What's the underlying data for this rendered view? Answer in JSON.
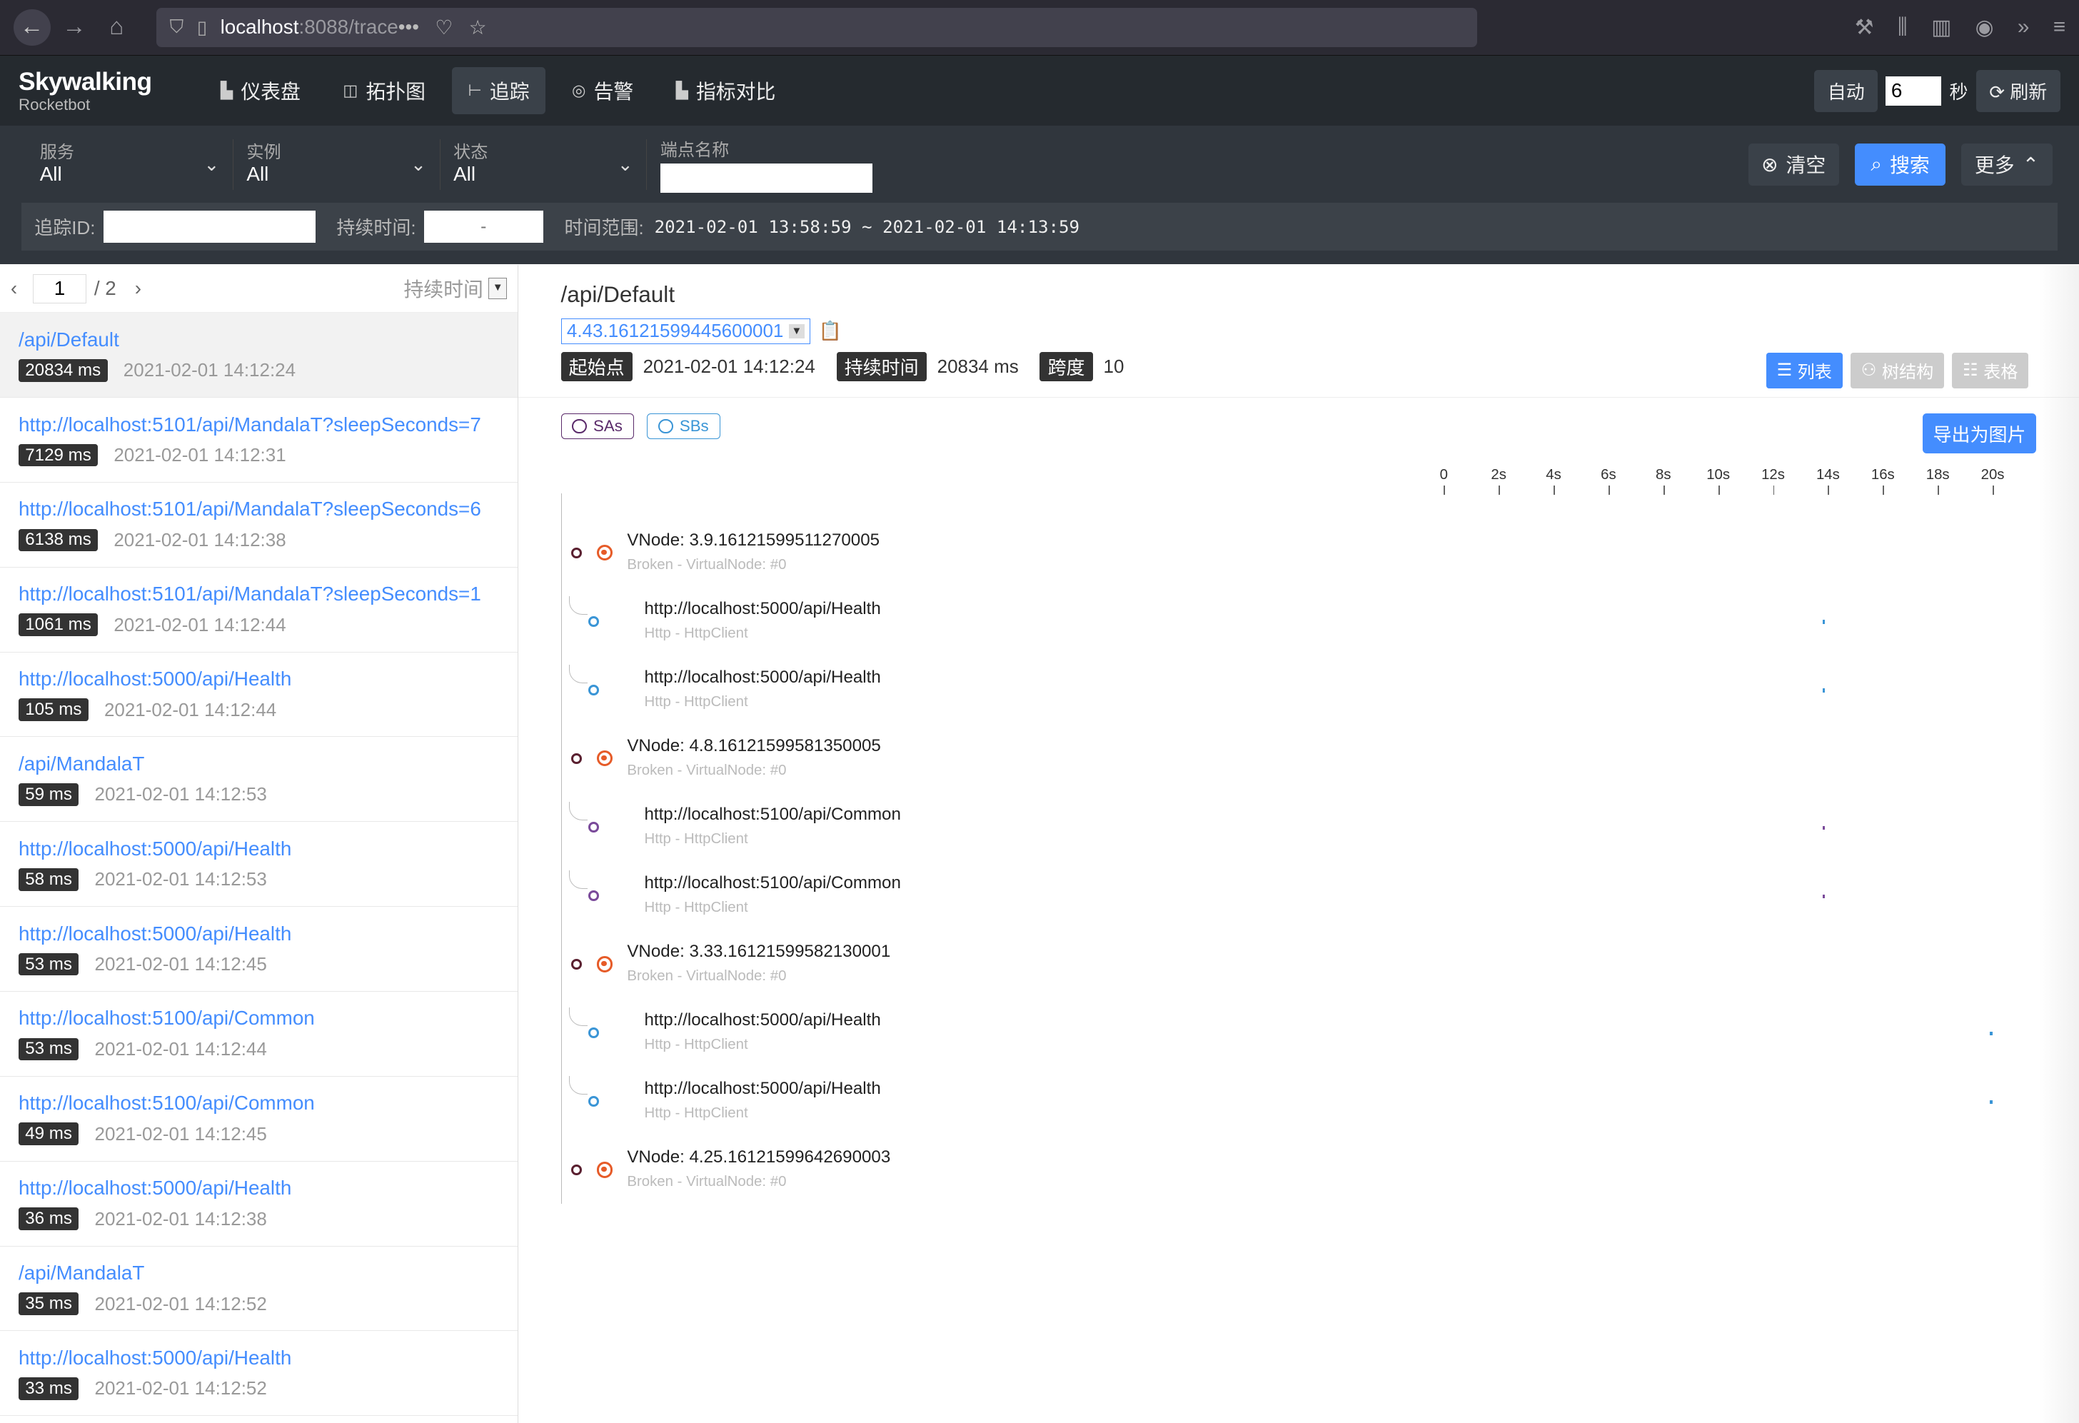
{
  "browser": {
    "host": "localhost",
    "path": ":8088/trace"
  },
  "app": {
    "logo_main": "Skywalking",
    "logo_sub": "Rocketbot",
    "menu": [
      {
        "label": "仪表盘",
        "icon": "dashboard-icon"
      },
      {
        "label": "拓扑图",
        "icon": "topology-icon"
      },
      {
        "label": "追踪",
        "icon": "trace-icon",
        "active": true
      },
      {
        "label": "告警",
        "icon": "alarm-icon"
      },
      {
        "label": "指标对比",
        "icon": "compare-icon"
      }
    ],
    "auto_label": "自动",
    "interval_value": "6",
    "seconds_label": "秒",
    "refresh_label": "刷新"
  },
  "filters": {
    "service": {
      "label": "服务",
      "value": "All"
    },
    "instance": {
      "label": "实例",
      "value": "All"
    },
    "status": {
      "label": "状态",
      "value": "All"
    },
    "endpoint": {
      "label": "端点名称",
      "value": ""
    },
    "clear_label": "清空",
    "search_label": "搜索",
    "more_label": "更多",
    "trace_id_label": "追踪ID:",
    "duration_label": "持续时间:",
    "duration_placeholder": "-",
    "range_label": "时间范围:",
    "range_value": "2021-02-01 13:58:59 ~ 2021-02-01 14:13:59"
  },
  "list": {
    "page": "1",
    "total": "/ 2",
    "sort_label": "持续时间",
    "items": [
      {
        "endpoint": "/api/Default",
        "duration": "20834 ms",
        "time": "2021-02-01 14:12:24"
      },
      {
        "endpoint": "http://localhost:5101/api/MandalaT?sleepSeconds=7",
        "duration": "7129 ms",
        "time": "2021-02-01 14:12:31"
      },
      {
        "endpoint": "http://localhost:5101/api/MandalaT?sleepSeconds=6",
        "duration": "6138 ms",
        "time": "2021-02-01 14:12:38"
      },
      {
        "endpoint": "http://localhost:5101/api/MandalaT?sleepSeconds=1",
        "duration": "1061 ms",
        "time": "2021-02-01 14:12:44"
      },
      {
        "endpoint": "http://localhost:5000/api/Health",
        "duration": "105 ms",
        "time": "2021-02-01 14:12:44"
      },
      {
        "endpoint": "/api/MandalaT",
        "duration": "59 ms",
        "time": "2021-02-01 14:12:53"
      },
      {
        "endpoint": "http://localhost:5000/api/Health",
        "duration": "58 ms",
        "time": "2021-02-01 14:12:53"
      },
      {
        "endpoint": "http://localhost:5000/api/Health",
        "duration": "53 ms",
        "time": "2021-02-01 14:12:45"
      },
      {
        "endpoint": "http://localhost:5100/api/Common",
        "duration": "53 ms",
        "time": "2021-02-01 14:12:44"
      },
      {
        "endpoint": "http://localhost:5100/api/Common",
        "duration": "49 ms",
        "time": "2021-02-01 14:12:45"
      },
      {
        "endpoint": "http://localhost:5000/api/Health",
        "duration": "36 ms",
        "time": "2021-02-01 14:12:38"
      },
      {
        "endpoint": "/api/MandalaT",
        "duration": "35 ms",
        "time": "2021-02-01 14:12:52"
      },
      {
        "endpoint": "http://localhost:5000/api/Health",
        "duration": "33 ms",
        "time": "2021-02-01 14:12:52"
      }
    ]
  },
  "detail": {
    "title": "/api/Default",
    "trace_id": "4.43.16121599445600001",
    "start_label": "起始点",
    "start_value": "2021-02-01 14:12:24",
    "duration_label": "持续时间",
    "duration_value": "20834 ms",
    "spans_label": "跨度",
    "spans_value": "10",
    "view_list": "列表",
    "view_tree": "树结构",
    "view_table": "表格",
    "sas_label": "SAs",
    "sbs_label": "SBs",
    "export_label": "导出为图片",
    "axis_ticks": [
      "0",
      "2s",
      "4s",
      "6s",
      "8s",
      "10s",
      "12s",
      "14s",
      "16s",
      "18s",
      "20s"
    ],
    "spans": [
      {
        "name": "VNode: 3.9.16121599511270005",
        "type": "Broken - VirtualNode: #0",
        "kind": "vnode"
      },
      {
        "name": "http://localhost:5000/api/Health",
        "type": "Http - HttpClient",
        "kind": "blue",
        "start_s": 13.8
      },
      {
        "name": "http://localhost:5000/api/Health",
        "type": "Http - HttpClient",
        "kind": "blue",
        "start_s": 13.8
      },
      {
        "name": "VNode: 4.8.16121599581350005",
        "type": "Broken - VirtualNode: #0",
        "kind": "vnode"
      },
      {
        "name": "http://localhost:5100/api/Common",
        "type": "Http - HttpClient",
        "kind": "purple",
        "start_s": 13.8
      },
      {
        "name": "http://localhost:5100/api/Common",
        "type": "Http - HttpClient",
        "kind": "purple",
        "start_s": 13.8
      },
      {
        "name": "VNode: 3.33.16121599582130001",
        "type": "Broken - VirtualNode: #0",
        "kind": "vnode"
      },
      {
        "name": "http://localhost:5000/api/Health",
        "type": "Http - HttpClient",
        "kind": "blue",
        "start_s": 19.9
      },
      {
        "name": "http://localhost:5000/api/Health",
        "type": "Http - HttpClient",
        "kind": "blue",
        "start_s": 19.9
      },
      {
        "name": "VNode: 4.25.16121599642690003",
        "type": "Broken - VirtualNode: #0",
        "kind": "vnode"
      }
    ],
    "colors": {
      "accent": "#448dfe",
      "vnode": "#e65b28",
      "blue": "#3a95d6",
      "purple": "#7a4a9a",
      "dark": "#5a2030"
    }
  }
}
